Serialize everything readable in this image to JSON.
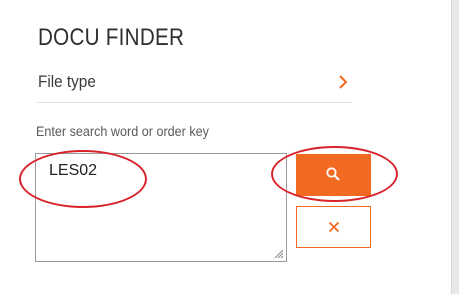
{
  "header": {
    "title": "DOCU FINDER"
  },
  "filter": {
    "file_type_label": "File type",
    "chevron_icon": "chevron-right-icon"
  },
  "search": {
    "label": "Enter search word or order key",
    "value": "LES02",
    "search_icon": "search-icon",
    "clear_icon": "close-icon"
  },
  "colors": {
    "accent": "#f26a22",
    "annotation": "#d9232a",
    "title_text": "#2f2f2f"
  }
}
